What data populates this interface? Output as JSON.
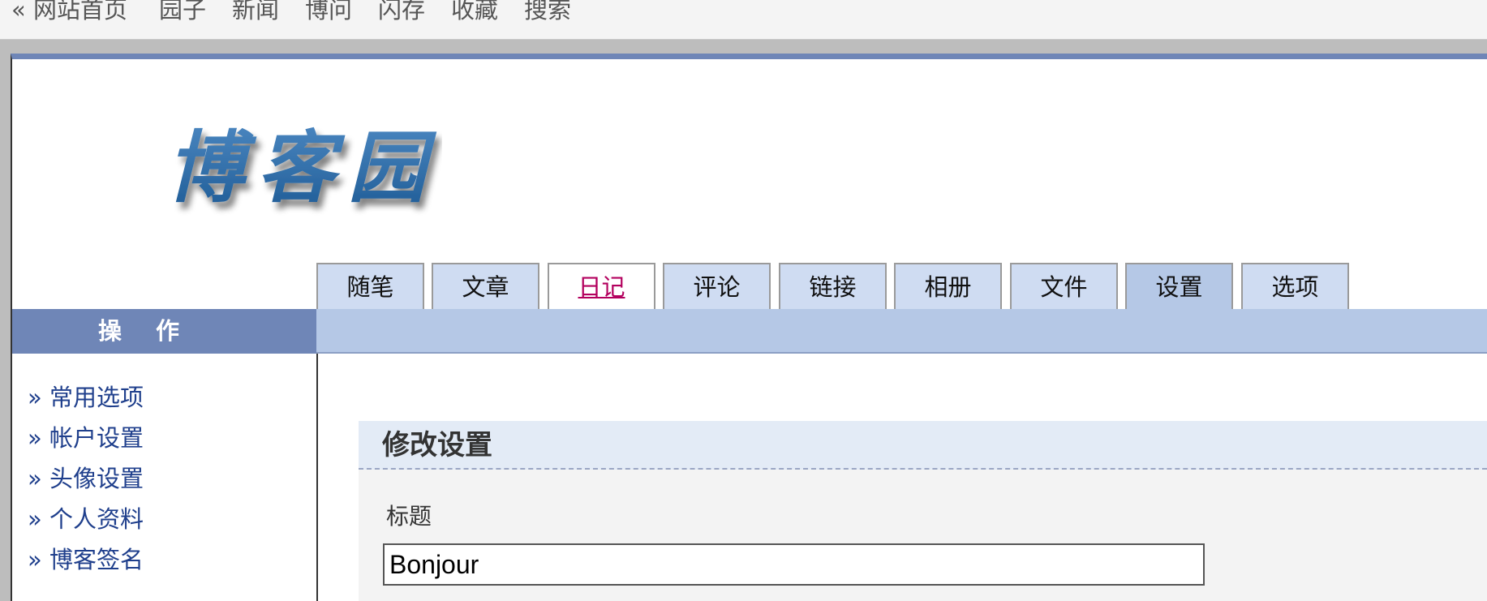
{
  "topnav": {
    "back_marker": "«",
    "links": [
      "网站首页",
      "园子",
      "新闻",
      "博问",
      "闪存",
      "收藏",
      "搜索"
    ]
  },
  "logo": {
    "text": "博客园"
  },
  "tabs": [
    {
      "label": "随笔"
    },
    {
      "label": "文章"
    },
    {
      "label": "日记"
    },
    {
      "label": "评论"
    },
    {
      "label": "链接"
    },
    {
      "label": "相册"
    },
    {
      "label": "文件"
    },
    {
      "label": "设置"
    },
    {
      "label": "选项"
    }
  ],
  "sidebar": {
    "header": "操作",
    "items": [
      "» 常用选项",
      "» 帐户设置",
      "» 头像设置",
      "» 个人资料",
      "» 博客签名"
    ]
  },
  "panel": {
    "title": "修改设置",
    "field_label": "标题",
    "title_value": "Bonjour"
  },
  "colors": {
    "accent": "#6f86b7",
    "tab_bg": "#cfdcf2",
    "active_tab_bg": "#b5c8e6",
    "link": "#1f3f8c",
    "visited_link": "#b3005e"
  }
}
